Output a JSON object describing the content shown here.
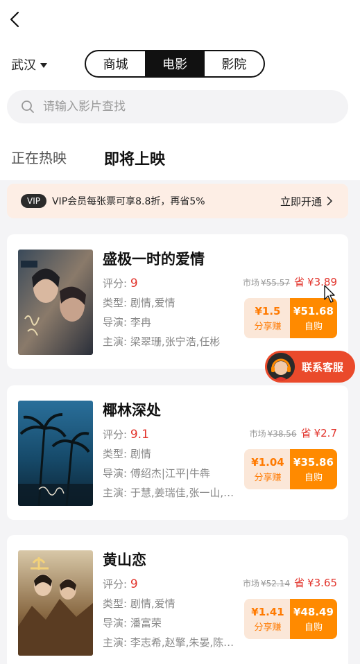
{
  "header": {
    "city": "武汉",
    "segments": [
      "商城",
      "电影",
      "影院"
    ],
    "active_segment": "电影"
  },
  "search": {
    "placeholder": "请输入影片查找"
  },
  "tabs": {
    "now_showing": "正在热映",
    "coming_soon": "即将上映"
  },
  "vip": {
    "badge": "VIP",
    "text": "VIP会员每张票可享8.8折，再省5%",
    "cta": "立即开通"
  },
  "movies": [
    {
      "title": "盛极一时的爱情",
      "score_label": "评分:",
      "score": "9",
      "genre_label": "类型:",
      "genre": "剧情,爱情",
      "director_label": "导演:",
      "director": "李冉",
      "cast_label": "主演:",
      "cast": "梁翠珊,张宁浩,任彬",
      "market_label": "市场",
      "market_price": "¥55.57",
      "save_label": "省",
      "save_price": "¥3.89",
      "share_amount": "¥1.5",
      "share_label": "分享赚",
      "buy_amount": "¥51.68",
      "buy_label": "自购"
    },
    {
      "title": "椰林深处",
      "score_label": "评分:",
      "score": "9.1",
      "genre_label": "类型:",
      "genre": "剧情",
      "director_label": "导演:",
      "director": "傅绍杰|江平|牛犇",
      "cast_label": "主演:",
      "cast": "于慧,姜瑞佳,张一山,…",
      "market_label": "市场",
      "market_price": "¥38.56",
      "save_label": "省",
      "save_price": "¥2.7",
      "share_amount": "¥1.04",
      "share_label": "分享赚",
      "buy_amount": "¥35.86",
      "buy_label": "自购"
    },
    {
      "title": "黄山恋",
      "score_label": "评分:",
      "score": "9",
      "genre_label": "类型:",
      "genre": "剧情,爱情",
      "director_label": "导演:",
      "director": "潘富荣",
      "cast_label": "主演:",
      "cast": "李志希,赵擎,朱晏,陈…",
      "market_label": "市场",
      "market_price": "¥52.14",
      "save_label": "省",
      "save_price": "¥3.65",
      "share_amount": "¥1.41",
      "share_label": "分享赚",
      "buy_amount": "¥48.49",
      "buy_label": "自购"
    }
  ],
  "customer_service": {
    "label": "联系客服"
  },
  "colors": {
    "accent": "#ff8a00",
    "price_red": "#e2332b",
    "vip_bg": "#fdeee5"
  }
}
